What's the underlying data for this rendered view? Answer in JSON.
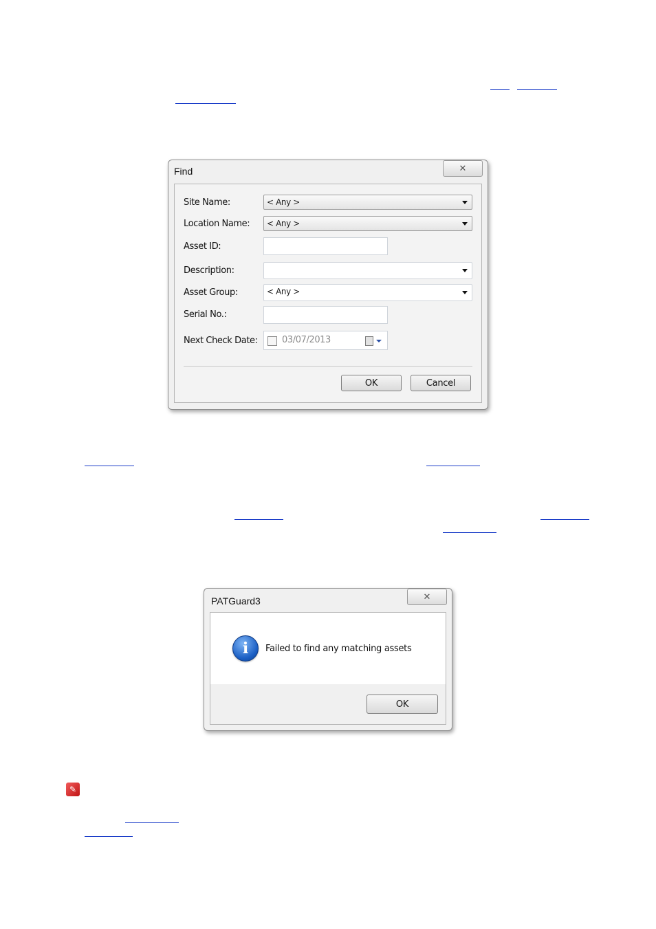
{
  "find_dialog": {
    "title": "Find",
    "close_label": "✕",
    "fields": {
      "site_name": {
        "label": "Site Name:",
        "value": "< Any >"
      },
      "location_name": {
        "label": "Location Name:",
        "value": "< Any >"
      },
      "asset_id": {
        "label": "Asset ID:",
        "value": ""
      },
      "description": {
        "label": "Description:",
        "value": ""
      },
      "asset_group": {
        "label": "Asset Group:",
        "value": "< Any >"
      },
      "serial_no": {
        "label": "Serial No.:",
        "value": ""
      },
      "next_check_date": {
        "label": "Next Check Date:",
        "value": "03/07/2013"
      }
    },
    "ok_label": "OK",
    "cancel_label": "Cancel"
  },
  "message_box": {
    "title": "PATGuard3",
    "close_label": "✕",
    "icon": "info-icon",
    "message": "Failed to find any matching assets",
    "ok_label": "OK"
  },
  "note_icon": "note-icon"
}
